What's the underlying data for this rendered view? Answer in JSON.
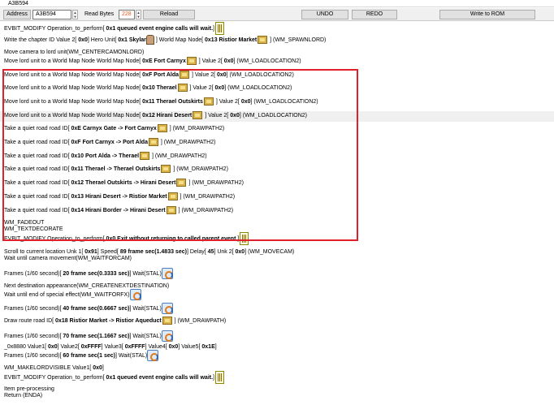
{
  "window": {
    "title": "A3B594"
  },
  "toolbar": {
    "address_label": "Address",
    "address_value": "A3B594",
    "read_bytes_label": "Read Bytes",
    "read_bytes_value": "228",
    "reload_label": "Reload",
    "undo_label": "UNDO",
    "redo_label": "REDO",
    "write_label": "Write to ROM"
  },
  "lines": [
    {
      "pre": "EVBIT_MODIFY  Operation_to_perform[ ",
      "bold": "0x1  queued event engine calls will wait.",
      "post": "]",
      "icon": "event-icon"
    },
    {
      "pre": "Write the chapter ID  Value 2[ ",
      "bold": "0x0",
      "mid": "] Hero Unit[ ",
      "bold2": "0x1 Skylar",
      "post": " ] World Map Node[  ",
      "bold3": "0x13   Ristior Market",
      "post2": " ] (WM_SPAWNLORD)"
    },
    {
      "text": "Move camera to lord unit(WM_CENTERCAMONLORD)"
    },
    {
      "pre": "Move lord unit to a World Map Node   World Map Node[  ",
      "bold": "0xE   Fort Carnyx",
      "post": " ] Value 2[ ",
      "bold2": "0x0",
      "post2": "] (WM_LOADLOCATION2)"
    },
    {
      "pre": "Move lord unit to a World Map Node   World Map Node[  ",
      "bold": "0xF   Port Alda",
      "post": " ] Value 2[ ",
      "bold2": "0x0",
      "post2": "] (WM_LOADLOCATION2)"
    },
    {
      "pre": "Move lord unit to a World Map Node   World Map Node[  ",
      "bold": "0x10   Therael",
      "post": " ] Value 2[ ",
      "bold2": "0x0",
      "post2": "] (WM_LOADLOCATION2)"
    },
    {
      "pre": "Move lord unit to a World Map Node   World Map Node[  ",
      "bold": "0x11   Therael Outskirts",
      "post": " ] Value 2[ ",
      "bold2": "0x0",
      "post2": "] (WM_LOADLOCATION2)"
    },
    {
      "pre": "Move lord unit to a World Map Node   World Map Node[  ",
      "bold": "0x12   Hirani Desert",
      "post": " ] Value 2[ ",
      "bold2": "0x0",
      "post2": "] (WM_LOADLOCATION2)"
    },
    {
      "pre": "Take a quiet road  road ID[ ",
      "bold": "0xE   Carnyx Gate -> Fort Carnyx",
      "post": " ] (WM_DRAWPATH2)"
    },
    {
      "pre": "Take a quiet road  road ID[ ",
      "bold": "0xF   Fort Carnyx -> Port Alda",
      "post": " ] (WM_DRAWPATH2)"
    },
    {
      "pre": "Take a quiet road  road ID[ ",
      "bold": "0x10   Port Alda -> Therael",
      "post": " ] (WM_DRAWPATH2)"
    },
    {
      "pre": "Take a quiet road  road ID[ ",
      "bold": "0x11   Therael -> Therael Outskirts",
      "post": " ] (WM_DRAWPATH2)"
    },
    {
      "pre": "Take a quiet road  road ID[ ",
      "bold": "0x12   Therael Outskirts -> Hirani Desert",
      "post": " ] (WM_DRAWPATH2)"
    },
    {
      "pre": "Take a quiet road  road ID[ ",
      "bold": "0x13   Hirani Desert -> Ristior Market",
      "post": " ] (WM_DRAWPATH2)"
    },
    {
      "pre": "Take a quiet road  road ID[ ",
      "bold": "0x14   Hirani Border -> Hirani Desert",
      "post": " ] (WM_DRAWPATH2)"
    },
    {
      "text": "WM_FADEOUT"
    },
    {
      "text": "WM_TEXTDECORATE"
    },
    {
      "pre": "EVBIT_MODIFY  Operation_to_perform[ ",
      "bold": "0x0  Exit without returning to called parent event.",
      "post": "]"
    },
    {
      "pre": "Scroll to current location Unk 1[ ",
      "bold": "0x91",
      "mid": "] Speed[ ",
      "bold2": "89  frame sec(1.4833 sec)",
      "post": "] Delay[ ",
      "bold3": "45",
      "post2": "] Unk 2[ ",
      "bold4": "0x0",
      "post3": "] (WM_MOVECAM)"
    },
    {
      "text": "Wait until camera movement(WM_WAITFORCAM)"
    },
    {
      "pre": "Frames (1/60 second)[  ",
      "bold": "20  frame sec(0.3333 sec)",
      "post": "] Wait(STAL)"
    },
    {
      "text": "Next destination appearance(WM_CREATENEXTDESTINATION)"
    },
    {
      "text": "Wait until end of special effect(WM_WAITFORFX)"
    },
    {
      "pre": "Frames (1/60 second)[  ",
      "bold": "40  frame sec(0.6667 sec)",
      "post": "] Wait(STAL)"
    },
    {
      "pre": "Draw route road ID[ ",
      "bold": "0x18   Ristior Market -> Ristior Aqueduct",
      "post": " ] (WM_DRAWPATH)"
    },
    {
      "pre": "Frames (1/60 second)[  ",
      "bold": "70  frame sec(1.1667 sec)",
      "post": "] Wait(STAL)"
    },
    {
      "pre": "_0x8880  Value1[ ",
      "bold": "0x0",
      "mid": "] Value2[ ",
      "bold2": "0xFFFF",
      "post": "] Value3[ ",
      "bold3": "0xFFFF",
      "post2": "] Value4[ ",
      "bold4": "0x0",
      "post3": "] Value5[ ",
      "bold5": "0x1E",
      "post4": "]"
    },
    {
      "pre": "Frames (1/60 second)[  ",
      "bold": "60  frame sec(1 sec)",
      "post": "] Wait(STAL)"
    },
    {
      "pre": "WM_MAKELORDVISIBLE   Value1[ ",
      "bold": "0x0",
      "post": "]"
    },
    {
      "pre": "EVBIT_MODIFY  Operation_to_perform[ ",
      "bold": "0x1  queued event engine calls will wait.",
      "post": "]"
    },
    {
      "text": "Item pre-processing"
    },
    {
      "text": "Return (ENDA)"
    }
  ]
}
